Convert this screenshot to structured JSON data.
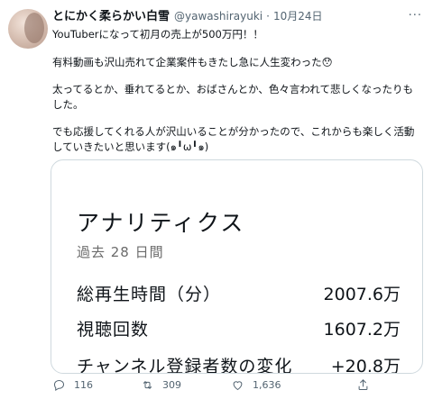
{
  "tweet": {
    "display_name": "とにかく柔らかい白雪",
    "handle": "@yawashirayuki",
    "separator": "·",
    "date": "10月24日",
    "more_icon": "more-icon",
    "paragraphs": [
      "YouTuberになって初月の売上が500万円！！",
      "有料動画も沢山売れて企業案件もきたし急に人生変わった😯",
      "太ってるとか、垂れてるとか、おばさんとか、色々言われて悲しくなったりもした。",
      "でも応援してくれる人が沢山いることが分かったので、これからも楽しく活動していきたいと思います(๑╹ω╹๑)"
    ]
  },
  "card": {
    "title": "アナリティクス",
    "subtitle": "過去 28 日間",
    "metrics": [
      {
        "label": "総再生時間（分）",
        "value": "2007.6万"
      },
      {
        "label": "視聴回数",
        "value": "1607.2万"
      },
      {
        "label": "チャンネル登録者数の変化",
        "value": "+20.8万"
      }
    ]
  },
  "actions": {
    "reply_count": "116",
    "retweet_count": "309",
    "like_count": "1,636",
    "icons": [
      "reply-icon",
      "retweet-icon",
      "like-icon",
      "share-icon"
    ]
  }
}
